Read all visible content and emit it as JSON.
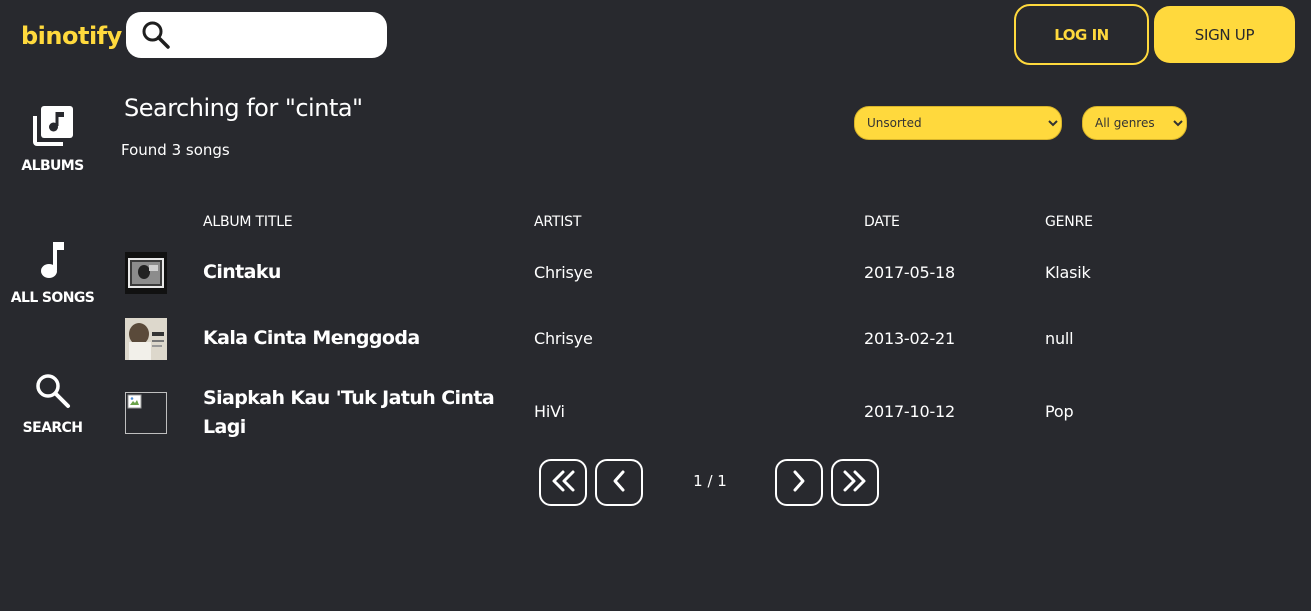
{
  "brand": {
    "name": "binotify",
    "color": "#ffd93d"
  },
  "header": {
    "search": {
      "value": "",
      "placeholder": ""
    },
    "login_label": "LOG IN",
    "signup_label": "SIGN UP"
  },
  "sidebar": {
    "items": [
      {
        "label": "ALBUMS",
        "icon": "album-icon"
      },
      {
        "label": "ALL SONGS",
        "icon": "music-note-icon"
      },
      {
        "label": "SEARCH",
        "icon": "search-icon"
      }
    ]
  },
  "main": {
    "title": "Searching for \"cinta\"",
    "found": "Found 3 songs",
    "sort": {
      "selected": "Unsorted"
    },
    "genre_filter": {
      "selected": "All genres"
    },
    "columns": [
      "ALBUM TITLE",
      "ARTIST",
      "DATE",
      "GENRE"
    ],
    "rows": [
      {
        "title": "Cintaku",
        "artist": "Chrisye",
        "date": "2017-05-18",
        "genre": "Klasik",
        "thumb": "album-cover"
      },
      {
        "title": "Kala Cinta Menggoda",
        "artist": "Chrisye",
        "date": "2013-02-21",
        "genre": "null",
        "thumb": "album-cover"
      },
      {
        "title": "Siapkah Kau 'Tuk Jatuh Cinta Lagi",
        "artist": "HiVi",
        "date": "2017-10-12",
        "genre": "Pop",
        "thumb": "broken-image"
      }
    ]
  },
  "pagination": {
    "page_info": "1 / 1"
  },
  "colors": {
    "background": "#28292e",
    "accent": "#ffd93d",
    "text": "#ffffff"
  }
}
